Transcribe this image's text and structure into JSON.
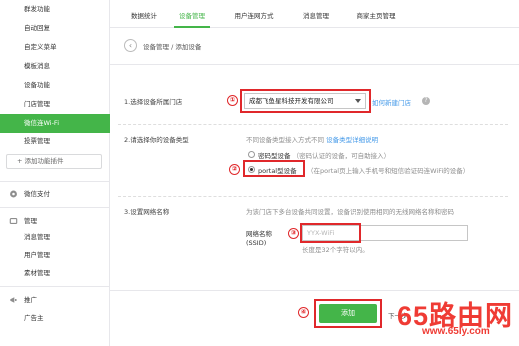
{
  "sidebar": {
    "items": [
      {
        "label": "群发功能"
      },
      {
        "label": "自动回复"
      },
      {
        "label": "自定义菜单"
      },
      {
        "label": "模板消息"
      },
      {
        "label": "设备功能"
      },
      {
        "label": "门店管理"
      },
      {
        "label": "微信连Wi-Fi"
      },
      {
        "label": "投票管理"
      }
    ],
    "add_plugin": "+ 添加功能插件",
    "pay": "微信支付",
    "manage_group": "管理",
    "manage_items": [
      {
        "label": "消息管理"
      },
      {
        "label": "用户管理"
      },
      {
        "label": "素材管理"
      }
    ],
    "promo_group": "推广",
    "promo_items": [
      {
        "label": "广告主"
      }
    ]
  },
  "tabs": [
    {
      "label": "数据统计"
    },
    {
      "label": "设备管理"
    },
    {
      "label": "用户连网方式"
    },
    {
      "label": "消息管理"
    },
    {
      "label": "商家主页管理"
    }
  ],
  "breadcrumb": "设备管理 / 添加设备",
  "step1": {
    "label": "1.选择设备所属门店",
    "selected_store": "成都飞鱼星科技开发有限公司",
    "link": "如何新建门店",
    "help": "?"
  },
  "step2": {
    "label": "2.请选择你的设备类型",
    "note": "不同设备类型接入方式不同",
    "note_link": "设备类型详细说明",
    "option1": "密码型设备",
    "option1_desc": "（密码认证的设备，可自助接入）",
    "option2": "portal型设备",
    "option2_desc": "（在portal页上输入手机号和短信验证码连WiFi的设备）"
  },
  "step3": {
    "label": "3.设置网络名称",
    "desc": "为该门店下多台设备共同设置，设备识别使用相同的无线网络名称和密码",
    "ssid_label_1": "网络名称",
    "ssid_label_2": "(SSID)",
    "ssid_placeholder": "YYX-WiFi",
    "ssid_hint": "长度是32个字符以内。"
  },
  "submit": {
    "label": "添加",
    "next": "下一步"
  },
  "markers": [
    "①",
    "②",
    "③",
    "④"
  ],
  "watermark": {
    "main": "65路由网",
    "url": "www.65ly.com"
  }
}
